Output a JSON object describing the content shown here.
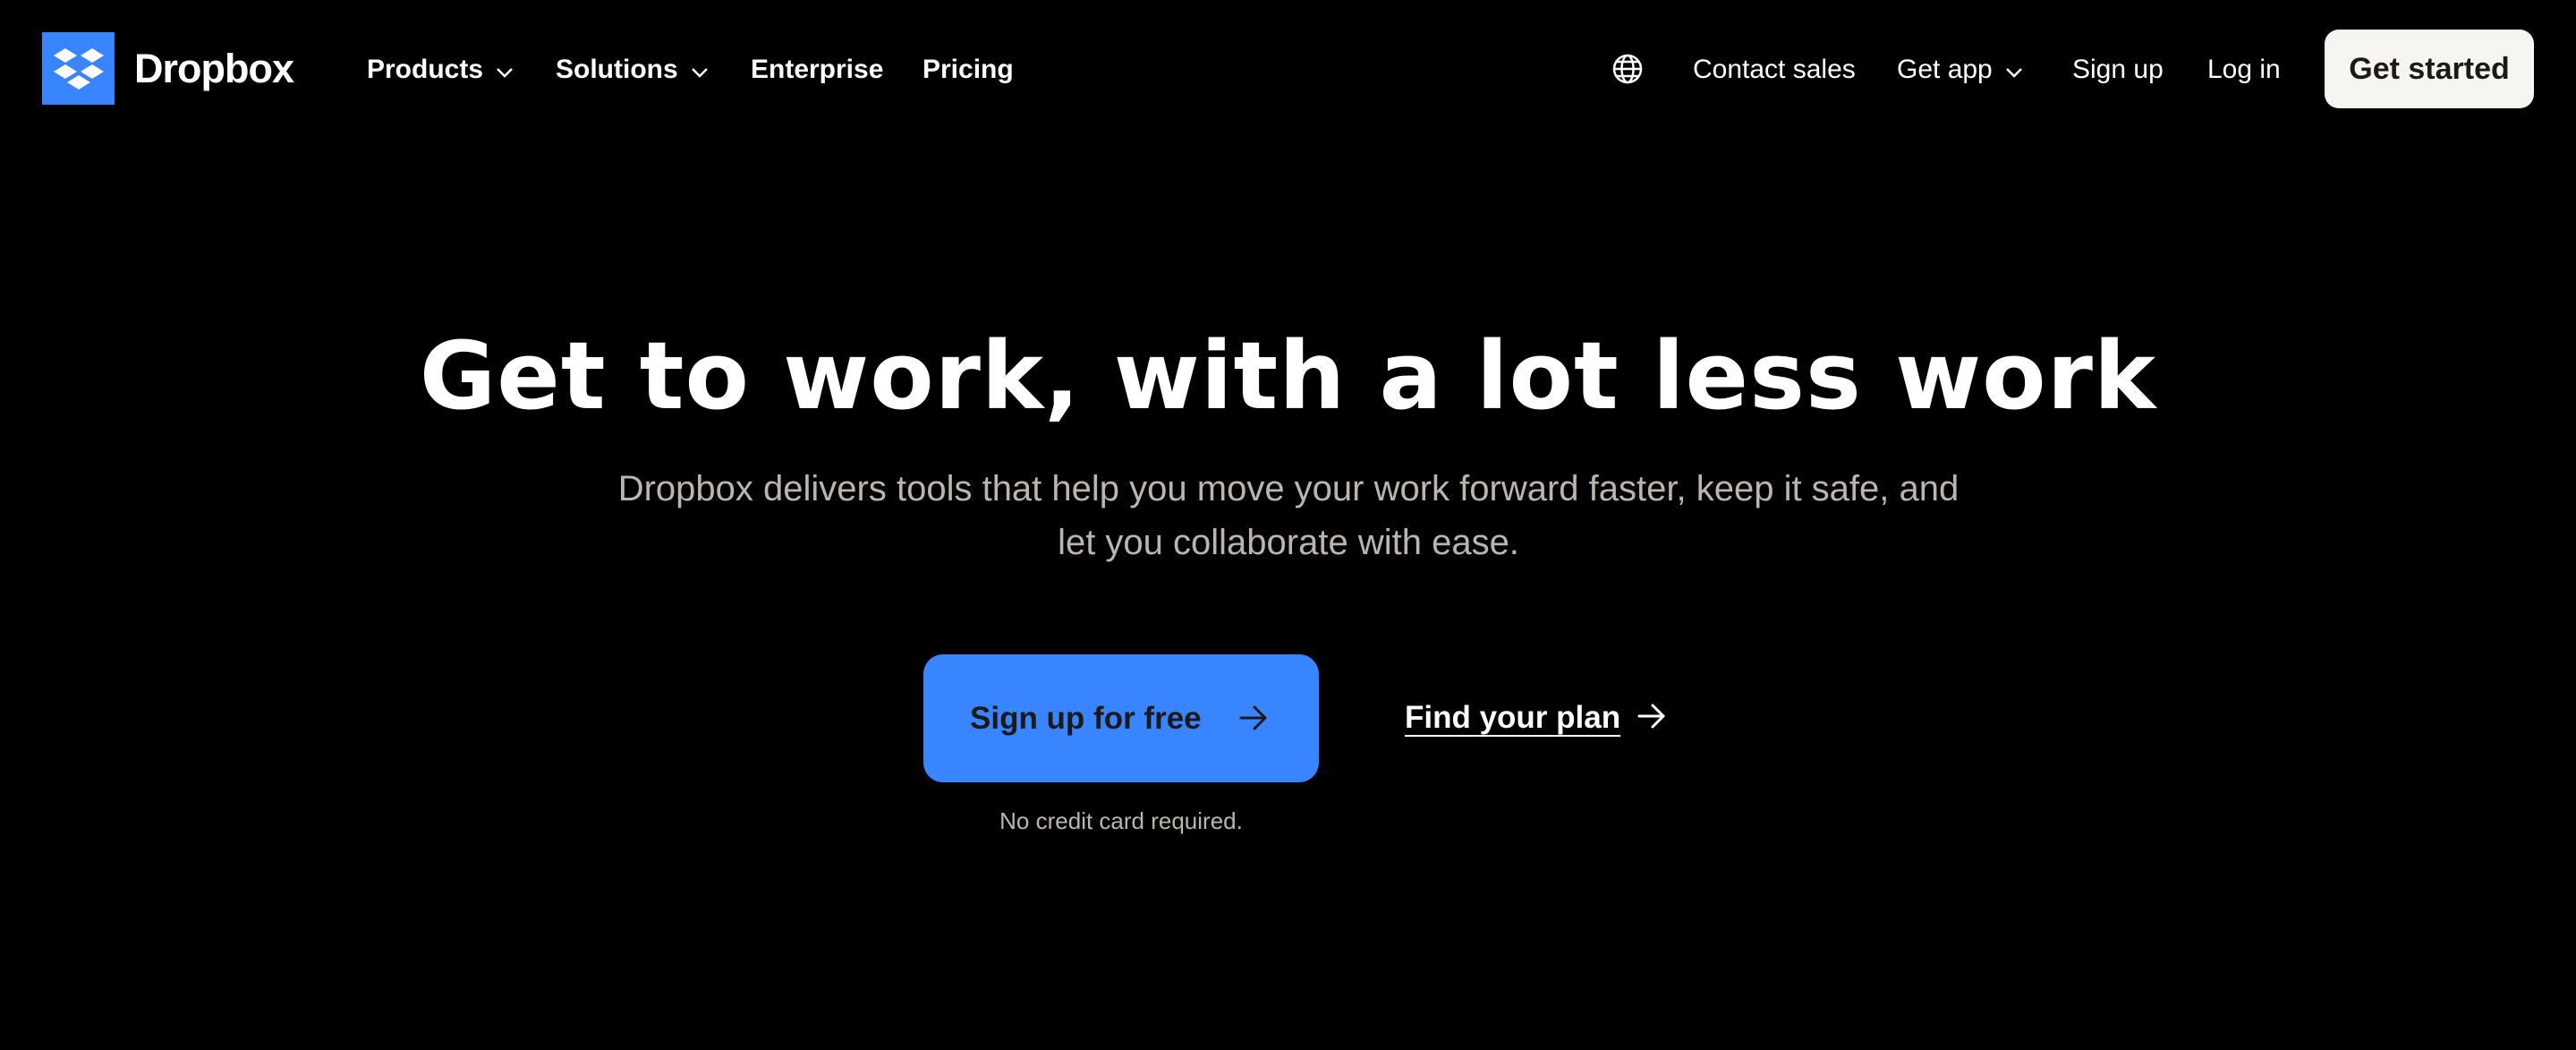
{
  "brand": {
    "name": "Dropbox",
    "color": "#3984ff"
  },
  "nav": {
    "left_items": [
      {
        "label": "Products",
        "has_dropdown": true
      },
      {
        "label": "Solutions",
        "has_dropdown": true
      },
      {
        "label": "Enterprise",
        "has_dropdown": false
      },
      {
        "label": "Pricing",
        "has_dropdown": false
      }
    ],
    "right_items": [
      {
        "label": "Contact sales",
        "has_dropdown": false
      },
      {
        "label": "Get app",
        "has_dropdown": true
      },
      {
        "label": "Sign up",
        "has_dropdown": false
      },
      {
        "label": "Log in",
        "has_dropdown": false
      }
    ],
    "language_icon": "globe-icon",
    "get_started_label": "Get started"
  },
  "hero": {
    "title": "Get to work, with a lot less work",
    "subtitle_line1": "Dropbox delivers tools that help you move your work forward faster, keep it safe, and",
    "subtitle_line2": "let you collaborate with ease.",
    "primary_cta": "Sign up for free",
    "primary_cta_note": "No credit card required.",
    "secondary_cta": "Find your plan"
  },
  "colors": {
    "background": "#000000",
    "primary_button": "#3984ff",
    "light_button": "#f7f5f2",
    "muted_text": "#bbb5ae",
    "dark_text": "#1e1919"
  }
}
